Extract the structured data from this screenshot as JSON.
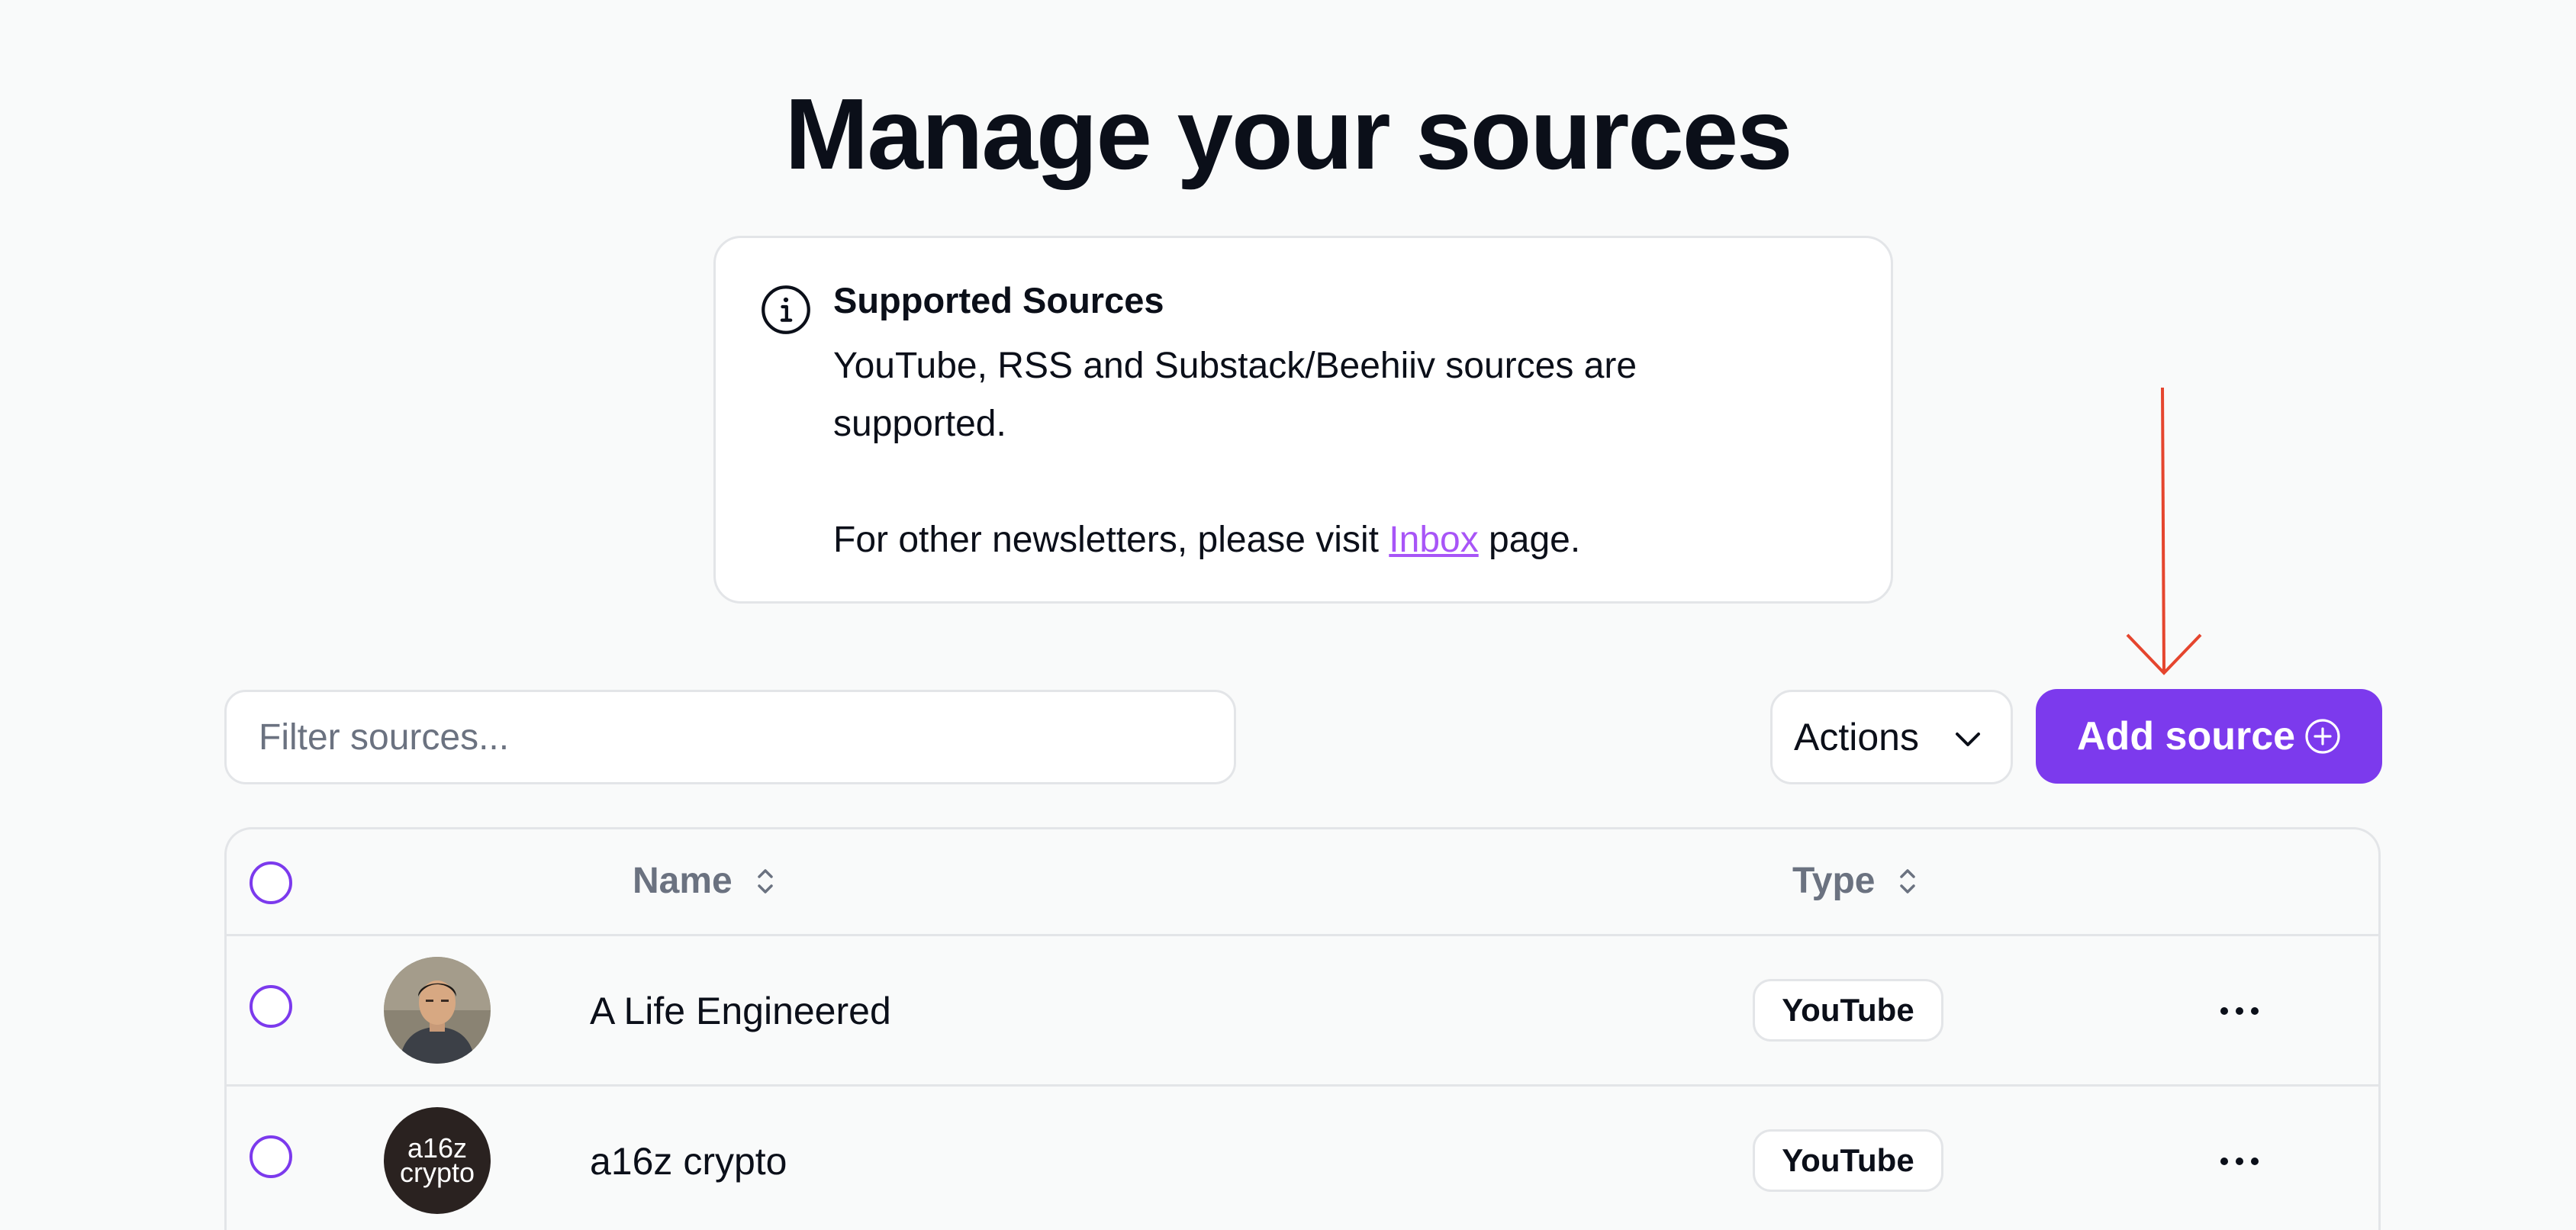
{
  "page": {
    "title": "Manage your sources"
  },
  "info_card": {
    "icon": "info-circle-icon",
    "title": "Supported Sources",
    "body_line1": "YouTube, RSS and Substack/Beehiiv sources are supported.",
    "body_line2_prefix": "For other newsletters, please visit ",
    "body_line2_link": "Inbox",
    "body_line2_suffix": " page."
  },
  "toolbar": {
    "filter_placeholder": "Filter sources...",
    "filter_value": "",
    "actions_label": "Actions",
    "actions_icon": "chevron-down-icon",
    "add_source_label": "Add source",
    "add_source_icon": "plus-circle-icon"
  },
  "annotation": {
    "arrow_icon": "arrow-down-icon",
    "arrow_color": "#e5452e"
  },
  "table": {
    "columns": [
      {
        "label": "Name",
        "sort_icon": "sort-icon"
      },
      {
        "label": "Type",
        "sort_icon": "sort-icon"
      }
    ],
    "rows": [
      {
        "name": "A Life Engineered",
        "type": "YouTube",
        "avatar": "person-photo",
        "more_icon": "more-horizontal-icon"
      },
      {
        "name": "a16z crypto",
        "type": "YouTube",
        "avatar": "a16z-crypto-logo",
        "avatar_text_1": "a16z",
        "avatar_text_2": "crypto",
        "more_icon": "more-horizontal-icon"
      }
    ]
  },
  "colors": {
    "accent": "#7c3aed",
    "link": "#a855f7",
    "border": "#e3e5e8",
    "background": "#f9fafa",
    "muted_text": "#6b7280"
  }
}
